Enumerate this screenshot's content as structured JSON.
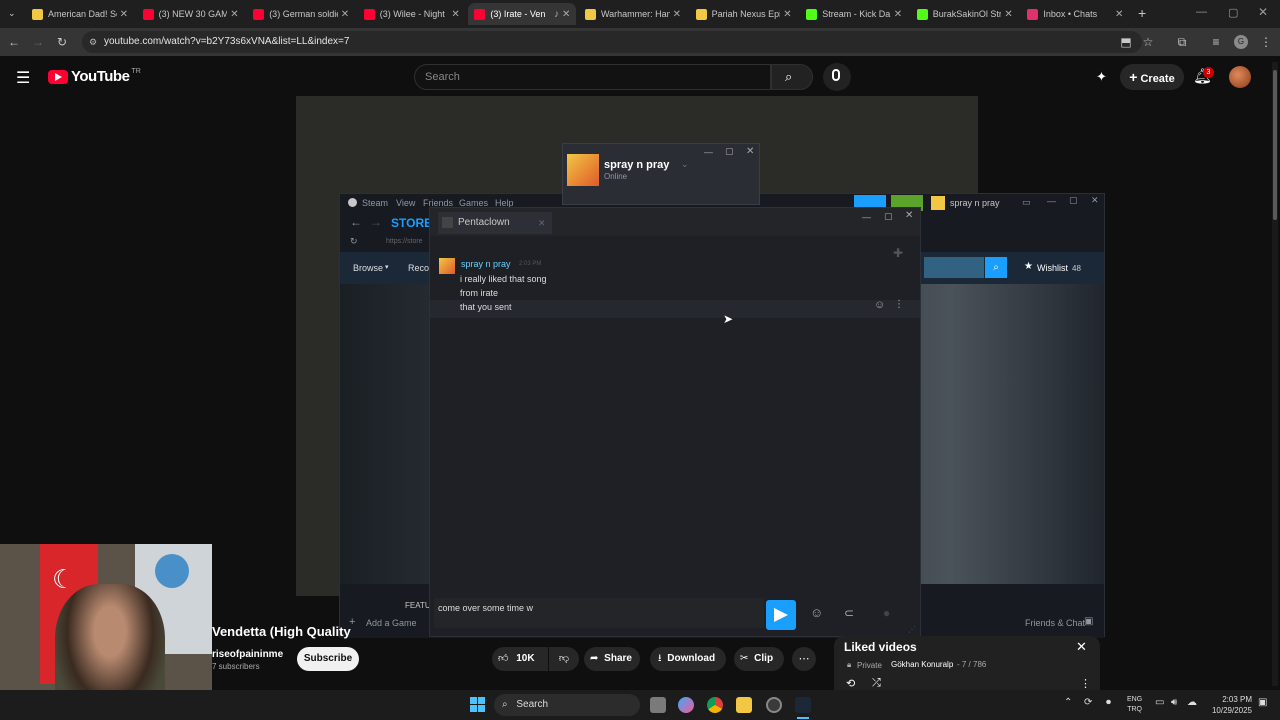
{
  "tabs": [
    {
      "label": "American Dad! Se",
      "color": "#f2c744"
    },
    {
      "label": "(3) NEW 30 GAM",
      "color": "#ff0033"
    },
    {
      "label": "(3) German soldie",
      "color": "#ff0033"
    },
    {
      "label": "(3) Wilee - Night",
      "color": "#ff0033"
    },
    {
      "label": "(3) Irate - Ven",
      "color": "#ff0033"
    },
    {
      "label": "Warhammer: Ham",
      "color": "#f2c744"
    },
    {
      "label": "Pariah Nexus Epis",
      "color": "#f2c744"
    },
    {
      "label": "Stream - Kick Da",
      "color": "#53fc18"
    },
    {
      "label": "BurakSakinOl Stre",
      "color": "#53fc18"
    },
    {
      "label": "Inbox • Chats",
      "color": "#e1306c"
    }
  ],
  "address": {
    "url": "youtube.com/watch?v=b2Y73s6xVNA&list=LL&index=7"
  },
  "youtube": {
    "logo_text": "YouTube",
    "region": "TR",
    "search_placeholder": "Search",
    "create_label": "Create",
    "notification_count": "3",
    "video_title": "Vendetta (High Quality",
    "channel_name": "riseofpaininme",
    "subscribers": "7 subscribers",
    "subscribe_label": "Subscribe",
    "like_count": "10K",
    "share_label": "Share",
    "download_label": "Download",
    "clip_label": "Clip",
    "playlist_title": "Liked videos",
    "playlist_privacy": "Private",
    "playlist_owner": "Gökhan Konuralp",
    "playlist_progress": "- 7 / 786"
  },
  "steam": {
    "menu": [
      "Steam",
      "View",
      "Friends",
      "Games",
      "Help"
    ],
    "username": "spray n pray",
    "store_label": "STORE",
    "url_stub": "https://store",
    "browse_label": "Browse",
    "reco_label": "Reco",
    "wishlist_label": "Wishlist",
    "wishlist_count": "48",
    "add_game_label": "Add a Game",
    "friends_chat_label": "Friends & Chat",
    "featured_label": "FEATU"
  },
  "friend_popup": {
    "name": "spray n pray",
    "status": "Online"
  },
  "chat": {
    "tab_name": "Pentaclown",
    "sender": "spray n pray",
    "time": "2:03 PM",
    "messages": [
      "i really liked that song",
      "from irate",
      "that you sent"
    ],
    "input_value": "come over some time w"
  },
  "taskbar": {
    "search_label": "Search",
    "lang_top": "ENG",
    "lang_bottom": "TRQ",
    "time": "2:03 PM",
    "date": "10/29/2025"
  }
}
